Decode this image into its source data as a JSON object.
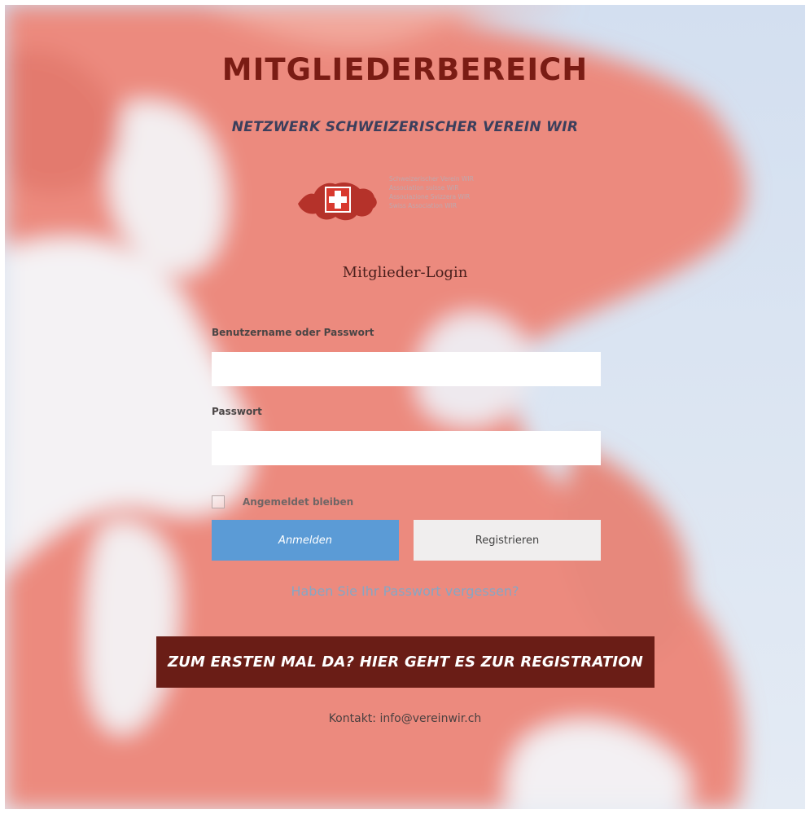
{
  "header": {
    "title": "MITGLIEDERBEREICH",
    "subtitle": "NETZWERK SCHWEIZERISCHER VEREIN WIR"
  },
  "logo": {
    "lines": [
      "Schweizerischer Verein WIR",
      "Association suisse WIR",
      "Associazione Svizzera WIR",
      "Swiss Association WIR"
    ]
  },
  "login": {
    "heading": "Mitglieder-Login",
    "username_label": "Benutzername oder Passwort",
    "username_value": "",
    "password_label": "Passwort",
    "password_value": "",
    "remember_label": "Angemeldet bleiben",
    "remember_checked": false,
    "login_button": "Anmelden",
    "register_button": "Registrieren",
    "forgot_link": "Haben Sie Ihr Passwort vergessen?"
  },
  "cta": {
    "label": "ZUM ERSTEN MAL DA? HIER GEHT ES ZUR REGISTRATION"
  },
  "contact": {
    "prefix": "Kontakt: ",
    "email": "info@vereinwir.ch"
  },
  "colors": {
    "title": "#7a1c14",
    "subtitle": "#3b3f5c",
    "login_button": "#5b9bd6",
    "cta_background": "#6a1d16",
    "forgot_link": "#86a6c4",
    "flag_red": "#ec8a7e"
  },
  "icons": {
    "logo": "swiss-map-flag-icon",
    "checkbox": "checkbox-empty-icon"
  }
}
